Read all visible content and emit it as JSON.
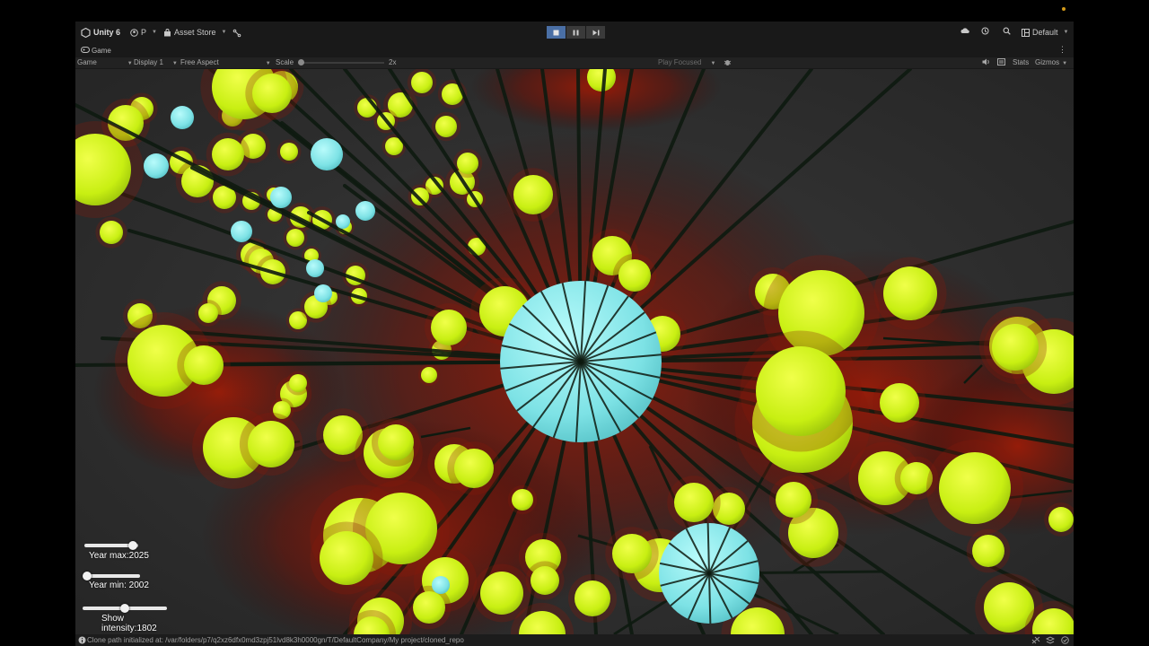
{
  "toolbar": {
    "app_name": "Unity 6",
    "account_label": "P",
    "asset_store_label": "Asset Store",
    "layout_label": "Default"
  },
  "game_tab": {
    "label": "Game"
  },
  "game_bar": {
    "mode_label": "Game",
    "display_label": "Display 1",
    "aspect_label": "Free Aspect",
    "scale_label": "Scale",
    "scale_value": "2x",
    "play_focused_label": "Play Focused",
    "stats_label": "Stats",
    "gizmos_label": "Gizmos"
  },
  "overlay": {
    "year_max_label": "Year max:",
    "year_max_value": "2025",
    "year_max_fill": 0.9,
    "year_min_label": "Year min: ",
    "year_min_value": "2002",
    "year_min_fill": 0.05,
    "intensity_label_1": "Show",
    "intensity_label_2": "intensity:",
    "intensity_value": "1802",
    "intensity_fill": 0.5
  },
  "status": {
    "message": "Clone path initialized at: /var/folders/p7/q2xz6dfx0md3zpj51lvd8k3h0000gn/T/DefaultCompany/My project/cloned_repo"
  },
  "colors": {
    "sphere_yellow": "#d4f41a",
    "sphere_cyan": "#7fe3e6",
    "glow_red": "#8a1a0a",
    "accent_play": "#4a6fa5"
  }
}
